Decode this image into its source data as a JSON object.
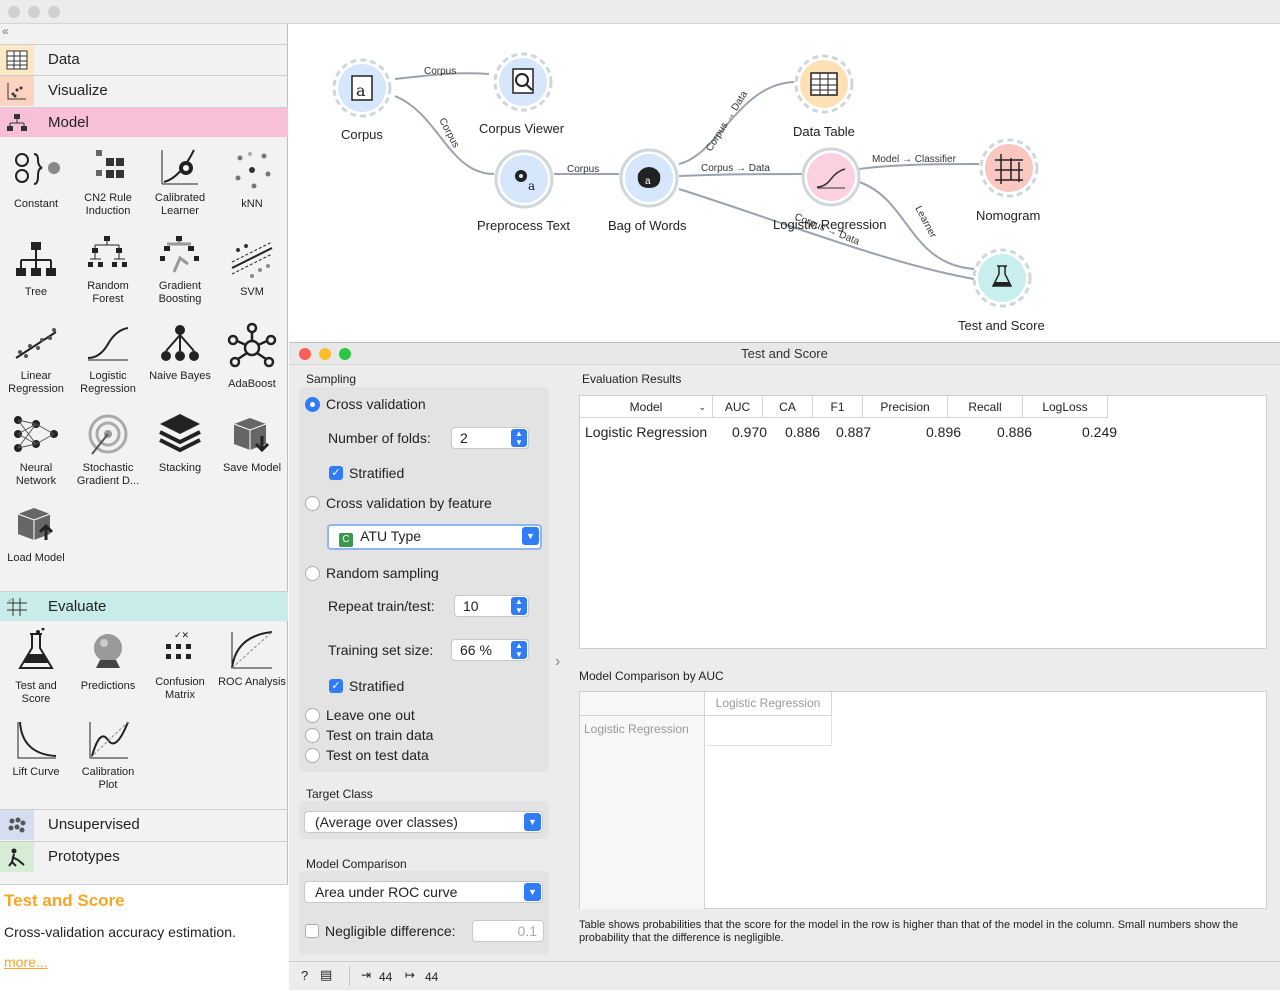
{
  "sidebar": {
    "categories": [
      {
        "label": "Data",
        "color": "#fde8c4"
      },
      {
        "label": "Visualize",
        "color": "#fbd3c0"
      },
      {
        "label": "Model",
        "color": "#f7c0d7"
      },
      {
        "label": "Evaluate",
        "color": "#c7ecea"
      },
      {
        "label": "Unsupervised",
        "color": "#d5def0"
      },
      {
        "label": "Prototypes",
        "color": "#d6ecd4"
      }
    ],
    "model_widgets": [
      {
        "label": "Constant"
      },
      {
        "label": "CN2 Rule Induction"
      },
      {
        "label": "Calibrated Learner"
      },
      {
        "label": "kNN"
      },
      {
        "label": "Tree"
      },
      {
        "label": "Random Forest"
      },
      {
        "label": "Gradient Boosting"
      },
      {
        "label": "SVM"
      },
      {
        "label": "Linear Regression"
      },
      {
        "label": "Logistic Regression"
      },
      {
        "label": "Naive Bayes"
      },
      {
        "label": "AdaBoost"
      },
      {
        "label": "Neural Network"
      },
      {
        "label": "Stochastic Gradient D..."
      },
      {
        "label": "Stacking"
      },
      {
        "label": "Save Model"
      },
      {
        "label": "Load Model"
      }
    ],
    "evaluate_widgets": [
      {
        "label": "Test and Score"
      },
      {
        "label": "Predictions"
      },
      {
        "label": "Confusion Matrix"
      },
      {
        "label": "ROC Analysis"
      },
      {
        "label": "Lift Curve"
      },
      {
        "label": "Calibration Plot"
      }
    ],
    "help": {
      "title": "Test and Score",
      "description": "Cross-validation accuracy estimation.",
      "more": "more..."
    }
  },
  "canvas": {
    "nodes": [
      {
        "label": "Corpus"
      },
      {
        "label": "Corpus Viewer"
      },
      {
        "label": "Preprocess Text"
      },
      {
        "label": "Bag of Words"
      },
      {
        "label": "Data Table"
      },
      {
        "label": "Logistic Regression"
      },
      {
        "label": "Nomogram"
      },
      {
        "label": "Test and Score"
      }
    ],
    "edges": [
      {
        "label": "Corpus"
      },
      {
        "label": "Corpus"
      },
      {
        "label": "Corpus"
      },
      {
        "label": "Corpus → Data"
      },
      {
        "label": "Corpus → Data"
      },
      {
        "label": "Model → Classifier"
      },
      {
        "label": "Learner"
      },
      {
        "label": "Corpus → Data"
      }
    ]
  },
  "dialog": {
    "title": "Test and Score",
    "sampling": {
      "section": "Sampling",
      "cross_validation": "Cross validation",
      "folds_label": "Number of folds:",
      "folds_value": "2",
      "stratified_1": "Stratified",
      "cv_by_feature": "Cross validation by feature",
      "feature_value": "ATU Type",
      "feature_badge": "C",
      "random_sampling": "Random sampling",
      "repeat_label": "Repeat train/test:",
      "repeat_value": "10",
      "train_size_label": "Training set size:",
      "train_size_value": "66 %",
      "stratified_2": "Stratified",
      "leave_one_out": "Leave one out",
      "test_on_train": "Test on train data",
      "test_on_test": "Test on test data"
    },
    "target_class": {
      "section": "Target Class",
      "value": "(Average over classes)"
    },
    "model_comparison": {
      "section": "Model Comparison",
      "value": "Area under ROC curve",
      "negligible_label": "Negligible difference:",
      "negligible_value": "0.1"
    },
    "results": {
      "section": "Evaluation Results",
      "columns": [
        "Model",
        "AUC",
        "CA",
        "F1",
        "Precision",
        "Recall",
        "LogLoss"
      ],
      "rows": [
        {
          "model": "Logistic Regression",
          "auc": "0.970",
          "ca": "0.886",
          "f1": "0.887",
          "precision": "0.896",
          "recall": "0.886",
          "logloss": "0.249"
        }
      ]
    },
    "comparison_table": {
      "section": "Model Comparison by AUC",
      "column": "Logistic Regression",
      "row": "Logistic Regression",
      "footnote": "Table shows probabilities that the score for the model in the row is higher than that of the model in the column. Small numbers show the probability that the difference is negligible."
    },
    "status": {
      "input_count": "44",
      "output_count": "44"
    }
  }
}
